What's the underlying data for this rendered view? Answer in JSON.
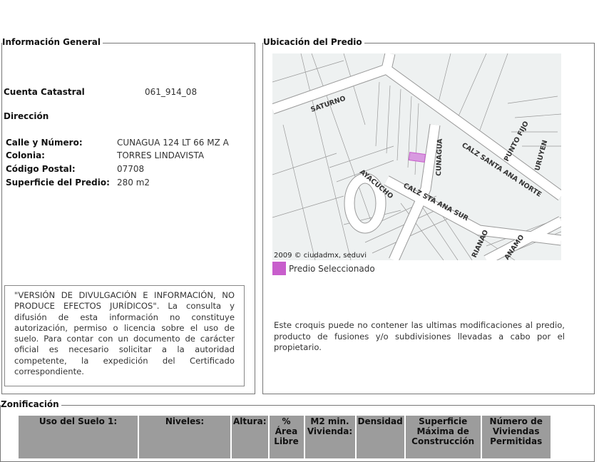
{
  "info": {
    "legend": "Información General",
    "cuenta_label": "Cuenta Catastral",
    "cuenta_value": "061_914_08",
    "direccion_label": "Dirección",
    "fields": [
      {
        "label": "Calle y Número:",
        "value": "CUNAGUA 124 LT 66 MZ A"
      },
      {
        "label": "Colonia:",
        "value": "TORRES LINDAVISTA"
      },
      {
        "label": "Código Postal:",
        "value": "07708"
      },
      {
        "label": "Superficie del Predio:",
        "value": "280 m2"
      }
    ],
    "disclaimer": "\"VERSIÓN DE DIVULGACIÓN E INFORMACIÓN, NO PRODUCE EFECTOS JURÍDICOS\". La consulta y difusión de esta información no constituye autorización, permiso o licencia sobre el uso de suelo. Para contar con un documento de carácter oficial es necesario solicitar a la autoridad competente, la expedición del Certificado correspondiente."
  },
  "ubicacion": {
    "legend": "Ubicación del Predio",
    "map": {
      "credit": "2009 © ciudadmx, seduvi",
      "streets": {
        "saturno": "SATURNO",
        "cunagua": "CUNAGUA",
        "norte": "CALZ SANTA ANA NORTE",
        "punto_fijo": "PUNTO FIJO",
        "uruyen": "URUYEN",
        "ayacucho": "AYACUCHO",
        "sur": "CALZ STA ANA SUR",
        "marianao": "RIANAO",
        "anamo": "ANAMO"
      },
      "selected_color": "#c85ecc"
    },
    "selected_label": "Predio Seleccionado",
    "note": "Este croquis puede no contener las ultimas modificaciones al predio, producto de fusiones y/o subdivisiones llevadas a cabo por el propietario."
  },
  "zonificacion": {
    "legend": "Zonificación",
    "headers": [
      "Uso del Suelo 1:",
      "Niveles:",
      "Altura:",
      "% Área Libre",
      "M2 min. Vivienda:",
      "Densidad",
      "Superficie Máxima de Construcción",
      "Número de Viviendas Permitidas"
    ]
  }
}
